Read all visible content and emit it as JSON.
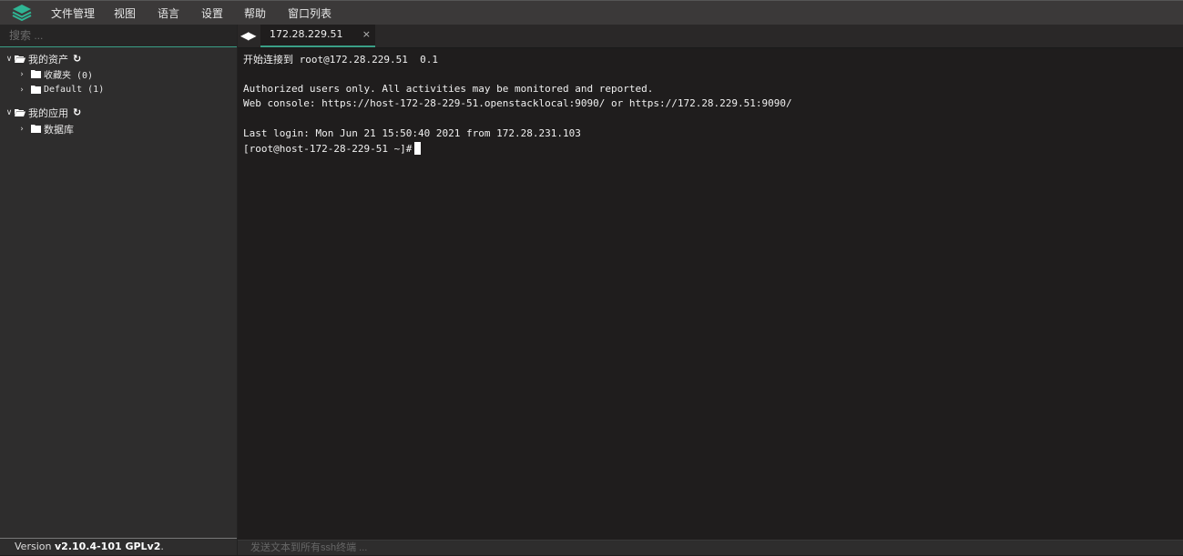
{
  "menubar": {
    "logo_icon": "stacked-layers-logo",
    "items": [
      "文件管理",
      "视图",
      "语言",
      "设置",
      "帮助",
      "窗口列表"
    ]
  },
  "sidebar": {
    "search_placeholder": "搜索 ...",
    "tree": [
      {
        "label": "我的资产",
        "expanded": true,
        "icon": "folder-open-icon",
        "refresh_icon": "refresh-icon",
        "children": [
          {
            "label": "收藏夹 (0)",
            "icon": "folder-icon"
          },
          {
            "label": "Default (1)",
            "icon": "folder-icon"
          }
        ]
      },
      {
        "label": "我的应用",
        "expanded": true,
        "icon": "folder-open-icon",
        "refresh_icon": "refresh-icon",
        "children": [
          {
            "label": "数据库",
            "icon": "folder-icon"
          }
        ]
      }
    ],
    "version_prefix": "Version ",
    "version": "v2.10.4-101 GPLv2",
    "version_suffix": "."
  },
  "tabs": {
    "nav_icon": "tab-nav-arrows-icon",
    "active": {
      "label": "172.28.229.51",
      "close": "×"
    }
  },
  "terminal": {
    "lines": [
      "开始连接到 root@172.28.229.51  0.1",
      "",
      "Authorized users only. All activities may be monitored and reported.",
      "Web console: https://host-172-28-229-51.openstacklocal:9090/ or https://172.28.229.51:9090/",
      "",
      "Last login: Mon Jun 21 15:50:40 2021 from 172.28.231.103",
      "[root@host-172-28-229-51 ~]#"
    ]
  },
  "sendbar": {
    "placeholder": "发送文本到所有ssh终端 ..."
  },
  "colors": {
    "accent": "#3a9f86",
    "background": "#1f1d1d",
    "panel": "#2e2d2d"
  }
}
